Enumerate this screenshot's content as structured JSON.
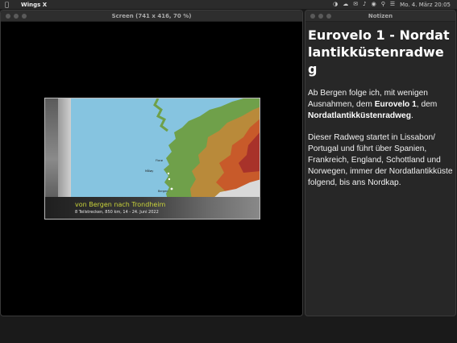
{
  "menubar": {
    "app_name": "Wings X",
    "clock": "Mo. 4. März 20:05",
    "status_icons": [
      "wifi-icon",
      "cloud-icon",
      "mail-icon",
      "volume-icon",
      "record-icon",
      "search-icon",
      "control-center-icon"
    ]
  },
  "screen_window": {
    "title": "Screen (741 x 416, 70 %)"
  },
  "slide": {
    "title": "von Bergen nach Trondheim",
    "subtitle": "8 Teilstrecken, 850 km, 14 - 24. Juni 2022",
    "map_labels": [
      "Florø",
      "Måløy",
      "Bergen"
    ],
    "colors": {
      "sea": "#7fbfdc",
      "caption_title": "#c8d23a"
    }
  },
  "notes_window": {
    "title": "Notizen",
    "heading": "Eurovelo 1 - Nordatlantikküstenradweg",
    "paragraph1": {
      "pre": "Ab Bergen folge ich, mit wenigen Ausnahmen, dem ",
      "bold1": "Eurovelo 1",
      "mid": ", dem ",
      "bold2": "Nordatlantikküstenradweg",
      "post": "."
    },
    "paragraph2": "Dieser Radweg startet in Lissabon/ Portugal und führt über Spanien, Frankreich, England, Schottland und Norwegen, immer der Nordatlantikküste folgend, bis ans Nordkap."
  }
}
